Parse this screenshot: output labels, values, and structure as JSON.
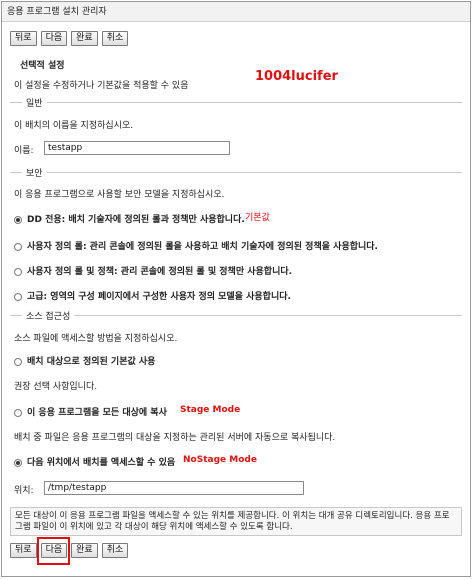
{
  "window": {
    "title": "응용 프로그램 설치 관리자"
  },
  "toolbar": {
    "back": "뒤로",
    "next": "다음",
    "finish": "완료",
    "cancel": "취소"
  },
  "optional": {
    "title": "선택적 설정",
    "description": "이 설정을 수정하거나 기본값을 적용할 수 있음",
    "watermark": "1004lucifer"
  },
  "general": {
    "section": "일반",
    "description": "이 배치의 이름을 지정하십시오.",
    "name_label": "이름:",
    "name_value": "testapp"
  },
  "security": {
    "section": "보안",
    "description": "이 응용 프로그램으로 사용할 보안 모델을 지정하십시오.",
    "options": [
      "DD 전용: 배치 기술자에 정의된 롤과 정책만 사용합니다.",
      "사용자 정의 롤: 관리 콘솔에 정의된 롤을 사용하고 배치 기술자에 정의된 정책을 사용합니다.",
      "사용자 정의 롤 및 정책: 관리 콘솔에 정의된 롤 및 정책만 사용합니다.",
      "고급: 영역의 구성 페이지에서 구성한 사용자 정의 모델을 사용합니다."
    ],
    "default_note": "기본값"
  },
  "source": {
    "section": "소스 접근성",
    "description": "소스 파일에 액세스할 방법을 지정하십시오.",
    "option_default": "배치 대상으로 정의된 기본값 사용",
    "recommended": "권장 선택 사항입니다.",
    "option_copy": "이 응용 프로그램을 모든 대상에 복사",
    "stage_note": "Stage Mode",
    "copy_description": "배치 중 파일은 응용 프로그램의 대상을 지정하는 관리된 서버에 자동으로 복사됩니다.",
    "option_location": "다음 위치에서 배치를 액세스할 수 있음",
    "nostage_note": "NoStage Mode",
    "location_label": "위치:",
    "location_value": "/tmp/testapp",
    "location_description": "모든 대상이 이 응용 프로그램 파일을 액세스할 수 있는 위치를 제공합니다. 이 위치는 대개 공유 디렉토리입니다. 응용 프로그램 파일이 이 위치에 있고 각 대상이 해당 위치에 액세스할 수 있도록 합니다."
  },
  "colors": {
    "annotation": "#e01010"
  }
}
